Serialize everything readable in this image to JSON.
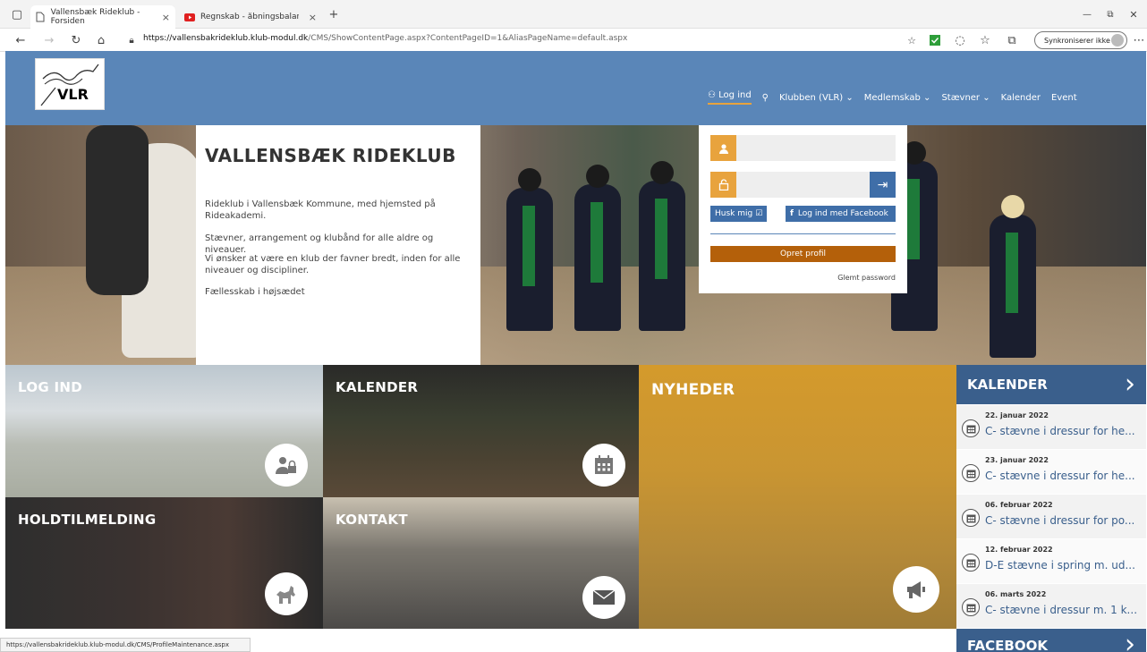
{
  "browser": {
    "tabs": [
      {
        "label": "Vallensbæk Rideklub - Forsiden",
        "close": "×"
      },
      {
        "label": "Regnskab - åbningsbalance - Yo",
        "close": "×"
      }
    ],
    "new_tab": "+",
    "url_host": "https://vallensbakrideklub.klub-modul.dk",
    "url_path": "/CMS/ShowContentPage.aspx?ContentPageID=1&AliasPageName=default.aspx",
    "sync_label": "Synkroniserer ikke",
    "status_url": "https://vallensbakrideklub.klub-modul.dk/CMS/ProfileMaintenance.aspx"
  },
  "site": {
    "logo_text": "VLR",
    "nav": {
      "login": "Log ind",
      "klubben": "Klubben (VLR)",
      "medlemskab": "Medlemskab",
      "staevner": "Stævner",
      "kalender": "Kalender",
      "event": "Event"
    },
    "intro": {
      "title": "VALLENSBÆK RIDEKLUB",
      "p1": "Rideklub i Vallensbæk Kommune, med hjemsted på Rideakademi.",
      "p2": "Stævner, arrangement og klubånd for alle aldre og niveauer.",
      "p3": "Vi ønsker at være en klub der favner bredt, inden for alle niveauer og discipliner.",
      "p4": "Fællesskab i højsædet"
    },
    "login": {
      "remember": "Husk mig",
      "facebook": "Log ind med Facebook",
      "create": "Opret profil",
      "forgot": "Glemt password"
    },
    "tiles": {
      "login": "LOG IND",
      "kalender": "KALENDER",
      "nyheder": "NYHEDER",
      "holdtilmelding": "HOLDTILMELDING",
      "kontakt": "KONTAKT"
    },
    "sidebar": {
      "title": "KALENDER",
      "items": [
        {
          "date": "22. januar 2022",
          "desc": "C- stævne i dressur for he..."
        },
        {
          "date": "23. januar 2022",
          "desc": "C- stævne i dressur for he..."
        },
        {
          "date": "06. februar 2022",
          "desc": "C- stævne i dressur for po..."
        },
        {
          "date": "12. februar 2022",
          "desc": "D-E stævne i spring m. ud..."
        },
        {
          "date": "06. marts 2022",
          "desc": "C- stævne i dressur m. 1 k..."
        }
      ],
      "facebook_title": "FACEBOOK"
    }
  }
}
